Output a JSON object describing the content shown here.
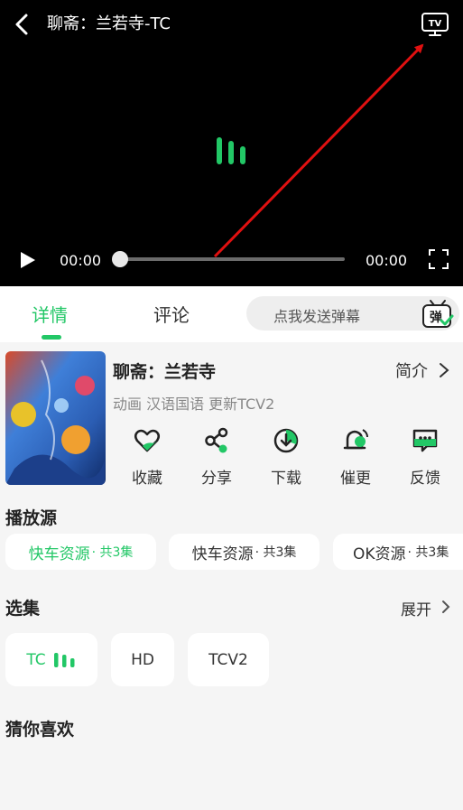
{
  "player": {
    "title": "聊斋：兰若寺-TC",
    "current_time": "00:00",
    "total_time": "00:00",
    "progress": 0
  },
  "tabs": {
    "detail": "详情",
    "comment": "评论",
    "danmu_placeholder": "点我发送弹幕",
    "danmu_icon_char": "弹"
  },
  "show": {
    "title": "聊斋：兰若寺",
    "intro_label": "简介",
    "meta": "动画 汉语国语 更新TCV2"
  },
  "actions": [
    {
      "label": "收藏",
      "icon": "heart-icon"
    },
    {
      "label": "分享",
      "icon": "share-icon"
    },
    {
      "label": "下载",
      "icon": "download-icon"
    },
    {
      "label": "催更",
      "icon": "bell-icon"
    },
    {
      "label": "反馈",
      "icon": "feedback-icon"
    }
  ],
  "sources": {
    "title": "播放源",
    "items": [
      {
        "name": "快车资源",
        "count": "· 共3集",
        "active": true
      },
      {
        "name": "快车资源",
        "count": "· 共3集",
        "active": false
      },
      {
        "name": "OK资源",
        "count": "· 共3集",
        "active": false
      }
    ]
  },
  "episodes": {
    "title": "选集",
    "expand_label": "展开",
    "items": [
      {
        "label": "TC",
        "active": true
      },
      {
        "label": "HD",
        "active": false
      },
      {
        "label": "TCV2",
        "active": false
      }
    ]
  },
  "recommend": {
    "title": "猜你喜欢"
  },
  "colors": {
    "accent": "#22c766",
    "annotation_arrow": "#e01010",
    "player_bg": "#000000"
  }
}
